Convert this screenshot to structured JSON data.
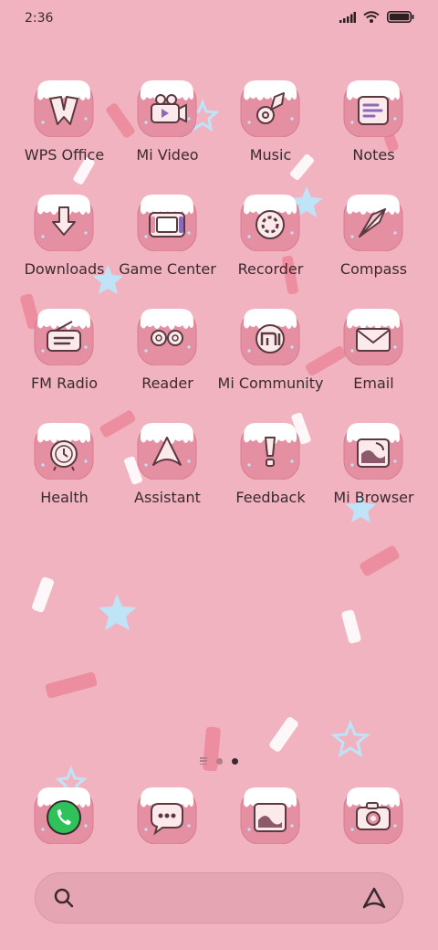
{
  "status_bar": {
    "time": "2:36"
  },
  "apps": [
    {
      "label": "WPS Office",
      "icon": "wps-office-icon"
    },
    {
      "label": "Mi Video",
      "icon": "mi-video-icon"
    },
    {
      "label": "Music",
      "icon": "music-icon"
    },
    {
      "label": "Notes",
      "icon": "notes-icon"
    },
    {
      "label": "Downloads",
      "icon": "downloads-icon"
    },
    {
      "label": "Game Center",
      "icon": "game-center-icon"
    },
    {
      "label": "Recorder",
      "icon": "recorder-icon"
    },
    {
      "label": "Compass",
      "icon": "compass-icon"
    },
    {
      "label": "FM Radio",
      "icon": "fm-radio-icon"
    },
    {
      "label": "Reader",
      "icon": "reader-icon"
    },
    {
      "label": "Mi Community",
      "icon": "mi-community-icon"
    },
    {
      "label": "Email",
      "icon": "email-icon"
    },
    {
      "label": "Health",
      "icon": "health-icon"
    },
    {
      "label": "Assistant",
      "icon": "assistant-icon"
    },
    {
      "label": "Feedback",
      "icon": "feedback-icon"
    },
    {
      "label": "Mi Browser",
      "icon": "mi-browser-icon"
    }
  ],
  "dock": [
    {
      "icon": "phone-icon"
    },
    {
      "icon": "messages-icon"
    },
    {
      "icon": "gallery-icon"
    },
    {
      "icon": "camera-icon"
    }
  ],
  "page_indicator": {
    "pages": 2,
    "current": 2
  },
  "colors": {
    "background": "#f2b3c0",
    "icon_tile": "#e58fa3",
    "frosting": "#ffffff",
    "label_text": "#3a2a2e"
  }
}
